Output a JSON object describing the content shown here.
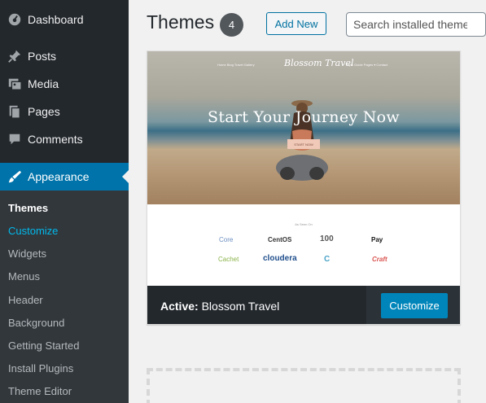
{
  "sidebar": {
    "items": [
      {
        "label": "Dashboard",
        "icon": "dashboard-icon"
      },
      {
        "label": "Posts",
        "icon": "pin-icon"
      },
      {
        "label": "Media",
        "icon": "media-icon"
      },
      {
        "label": "Pages",
        "icon": "pages-icon"
      },
      {
        "label": "Comments",
        "icon": "comment-icon"
      },
      {
        "label": "Appearance",
        "icon": "brush-icon"
      }
    ],
    "submenu": [
      {
        "label": "Themes"
      },
      {
        "label": "Customize"
      },
      {
        "label": "Widgets"
      },
      {
        "label": "Menus"
      },
      {
        "label": "Header"
      },
      {
        "label": "Background"
      },
      {
        "label": "Getting Started"
      },
      {
        "label": "Install Plugins"
      },
      {
        "label": "Theme Editor"
      }
    ]
  },
  "header": {
    "title": "Themes",
    "count": "4",
    "add_new": "Add New",
    "search_placeholder": "Search installed themes..."
  },
  "theme": {
    "screenshot": {
      "nav_left": "Home   Blog   Travel   Gallery",
      "nav_right": "Style Guide   Pages ▾   Contact",
      "logo": "Blossom Travel",
      "hero_title": "Start Your Journey Now",
      "hero_button": "START NOW",
      "clients_heading": "As Seen On",
      "client_logos": [
        "Core",
        "CentOS",
        "100",
        "Pay",
        "Cachet",
        "cloudera",
        "C",
        "Craft"
      ]
    },
    "active_prefix": "Active:",
    "name": "Blossom Travel",
    "customize": "Customize"
  },
  "colors": {
    "sidebar_bg": "#23282d",
    "submenu_bg": "#32373c",
    "accent": "#0073aa",
    "button_primary": "#0085ba"
  }
}
